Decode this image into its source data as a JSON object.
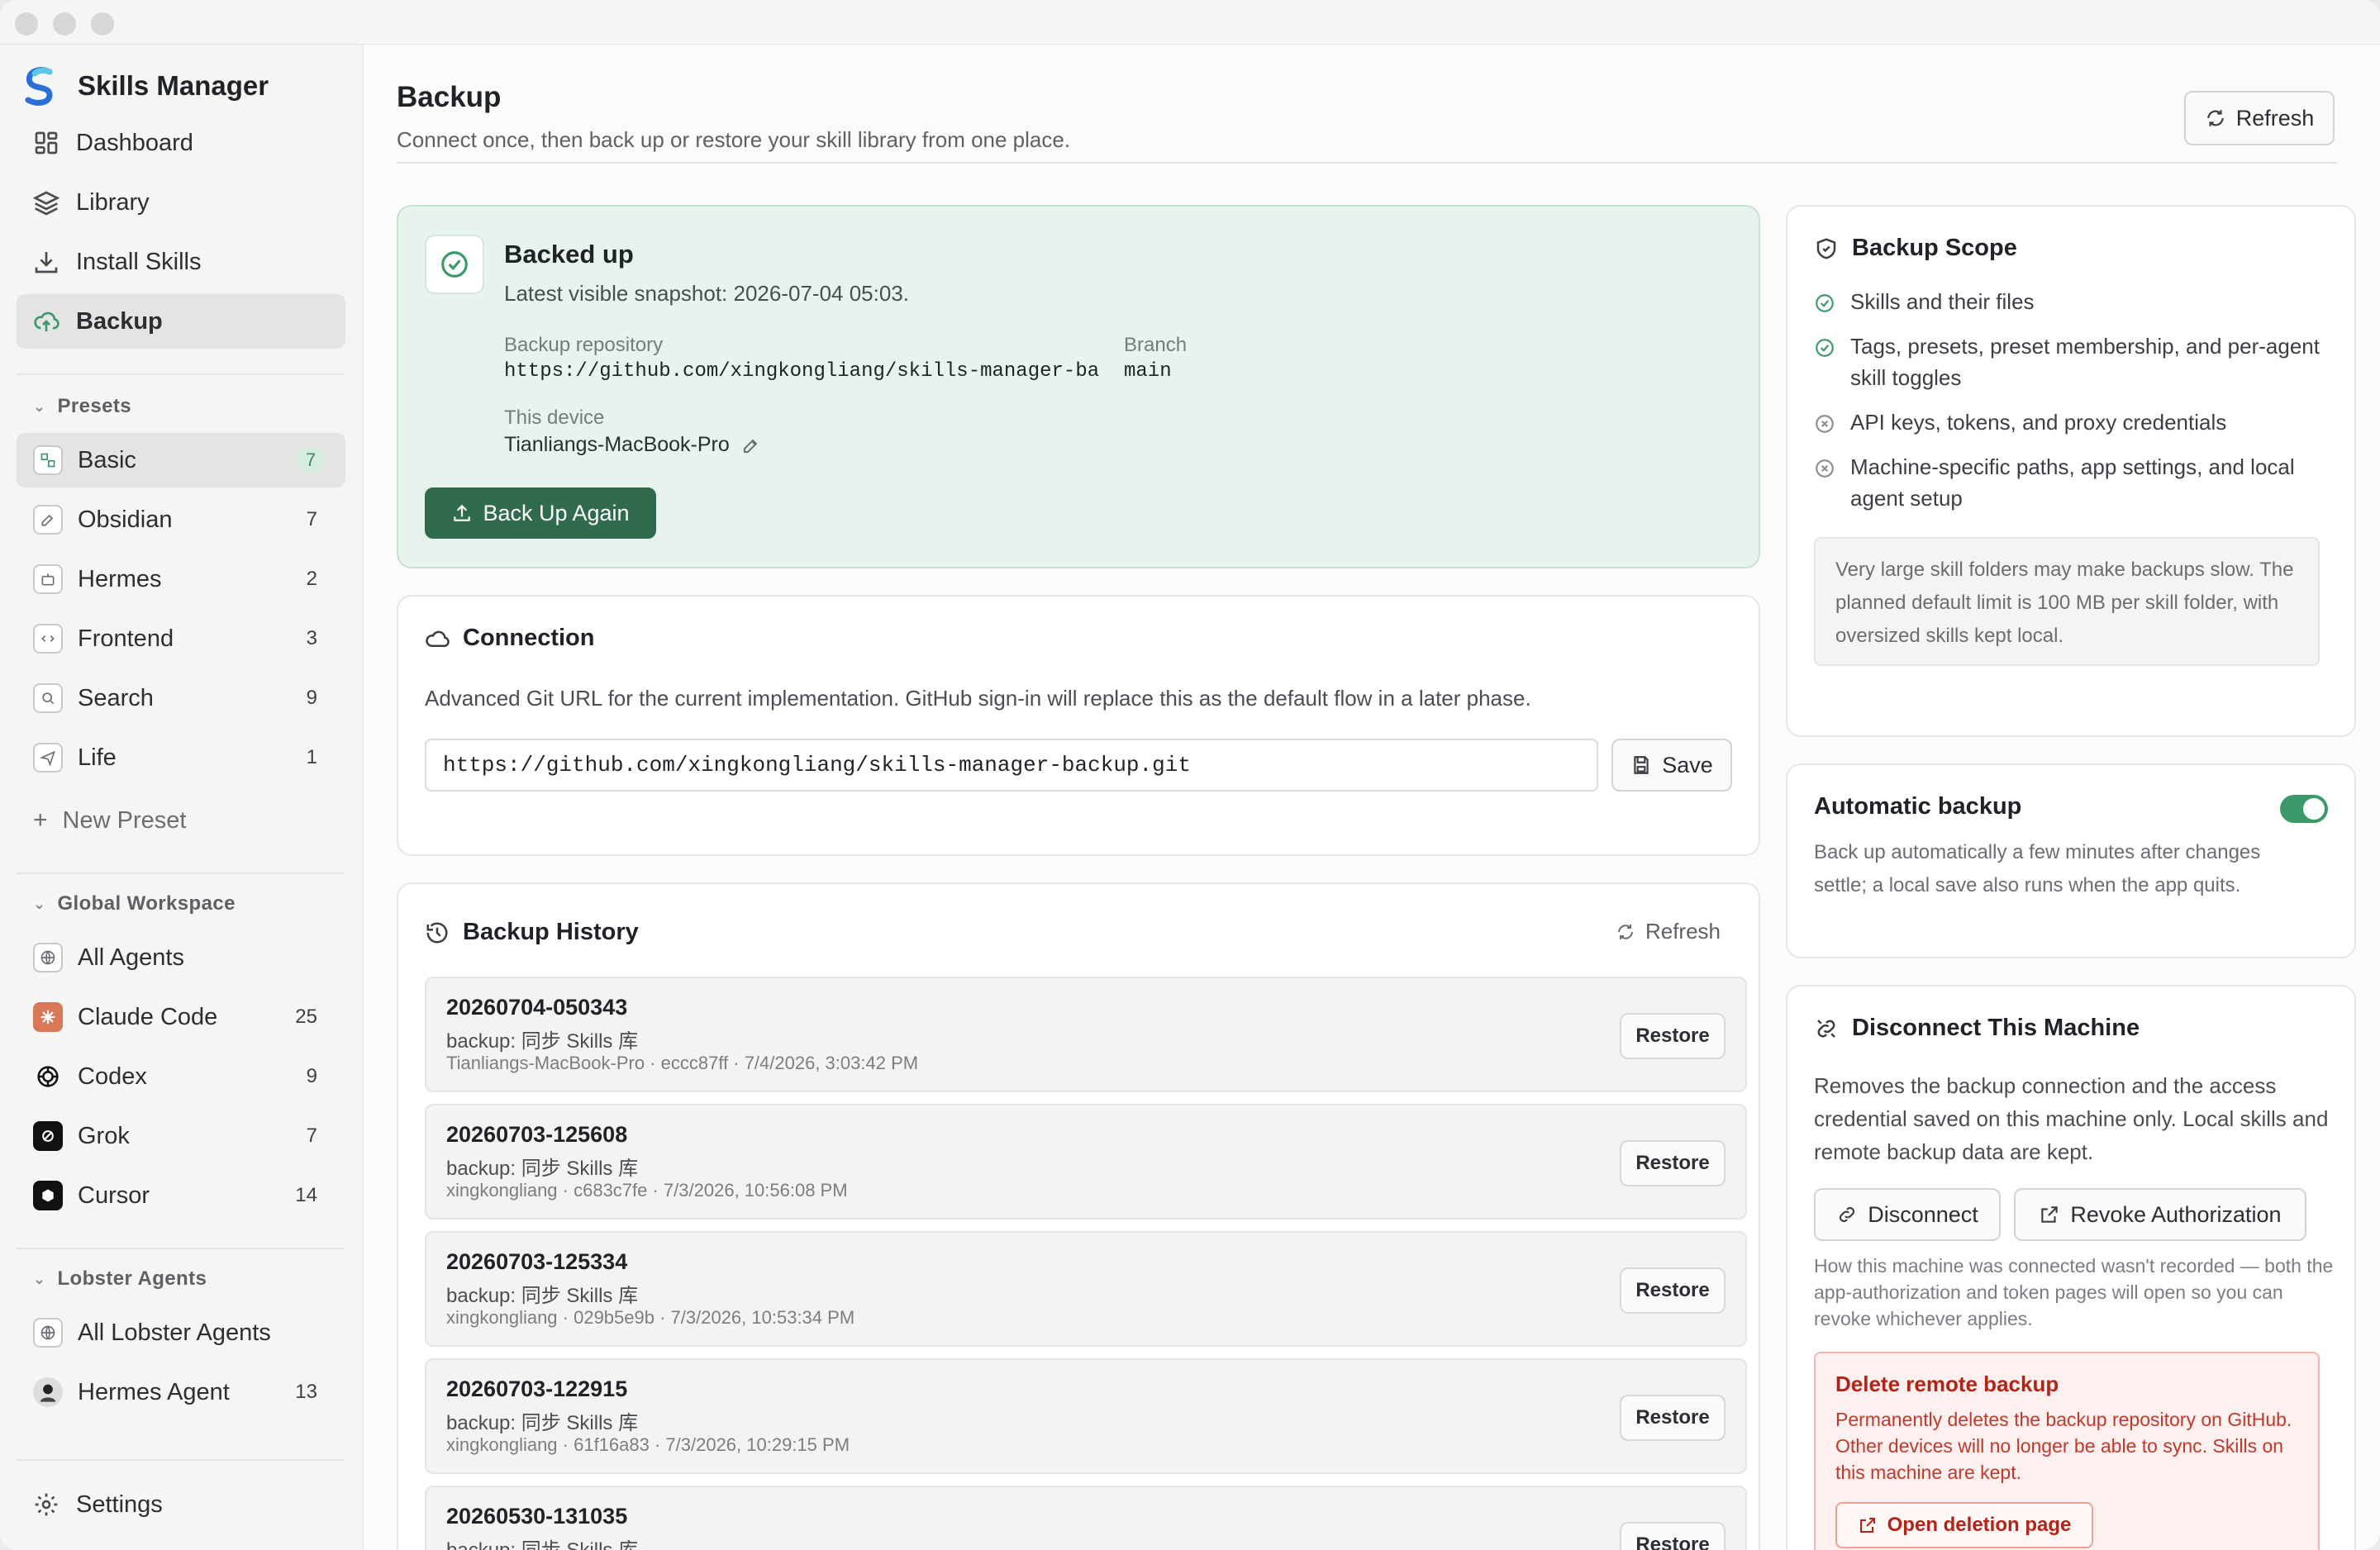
{
  "app": {
    "title": "Skills Manager"
  },
  "sidebar": {
    "nav": [
      {
        "label": "Dashboard",
        "icon": "dashboard-icon"
      },
      {
        "label": "Library",
        "icon": "layers-icon"
      },
      {
        "label": "Install Skills",
        "icon": "download-icon"
      },
      {
        "label": "Backup",
        "icon": "cloud-upload-icon"
      }
    ],
    "presets_header": "Presets",
    "presets": [
      {
        "label": "Basic",
        "count": "7"
      },
      {
        "label": "Obsidian",
        "count": "7"
      },
      {
        "label": "Hermes",
        "count": "2"
      },
      {
        "label": "Frontend",
        "count": "3"
      },
      {
        "label": "Search",
        "count": "9"
      },
      {
        "label": "Life",
        "count": "1"
      }
    ],
    "new_preset": "New Preset",
    "global_header": "Global Workspace",
    "global": [
      {
        "label": "All Agents",
        "count": ""
      },
      {
        "label": "Claude Code",
        "count": "25"
      },
      {
        "label": "Codex",
        "count": "9"
      },
      {
        "label": "Grok",
        "count": "7"
      },
      {
        "label": "Cursor",
        "count": "14"
      }
    ],
    "lobster_header": "Lobster Agents",
    "lobster": [
      {
        "label": "All Lobster Agents",
        "count": ""
      },
      {
        "label": "Hermes Agent",
        "count": "13"
      }
    ],
    "settings": "Settings"
  },
  "page": {
    "title": "Backup",
    "subtitle": "Connect once, then back up or restore your skill library from one place.",
    "refresh": "Refresh"
  },
  "status": {
    "title": "Backed up",
    "snapshot": "Latest visible snapshot: 2026-07-04 05:03.",
    "repo_label": "Backup repository",
    "repo_value": "https://github.com/xingkongliang/skills-manager-ba…",
    "branch_label": "Branch",
    "branch_value": "main",
    "device_label": "This device",
    "device_value": "Tianliangs-MacBook-Pro",
    "backup_btn": "Back Up Again"
  },
  "connection": {
    "title": "Connection",
    "desc": "Advanced Git URL for the current implementation. GitHub sign-in will replace this as the default flow in a later phase.",
    "url": "https://github.com/xingkongliang/skills-manager-backup.git",
    "save": "Save"
  },
  "history": {
    "title": "Backup History",
    "refresh": "Refresh",
    "restore": "Restore",
    "items": [
      {
        "id": "20260704-050343",
        "msg": "backup: 同步 Skills 库",
        "meta": "Tianliangs-MacBook-Pro · eccc87ff · 7/4/2026, 3:03:42 PM"
      },
      {
        "id": "20260703-125608",
        "msg": "backup: 同步 Skills 库",
        "meta": "xingkongliang · c683c7fe · 7/3/2026, 10:56:08 PM"
      },
      {
        "id": "20260703-125334",
        "msg": "backup: 同步 Skills 库",
        "meta": "xingkongliang · 029b5e9b · 7/3/2026, 10:53:34 PM"
      },
      {
        "id": "20260703-122915",
        "msg": "backup: 同步 Skills 库",
        "meta": "xingkongliang · 61f16a83 · 7/3/2026, 10:29:15 PM"
      },
      {
        "id": "20260530-131035",
        "msg": "backup: 同步 Skills 库",
        "meta": ""
      }
    ]
  },
  "scope": {
    "title": "Backup Scope",
    "items": [
      {
        "text": "Skills and their files",
        "included": true
      },
      {
        "text": "Tags, presets, preset membership, and per-agent skill toggles",
        "included": true
      },
      {
        "text": "API keys, tokens, and proxy credentials",
        "included": false
      },
      {
        "text": "Machine-specific paths, app settings, and local agent setup",
        "included": false
      }
    ],
    "note": "Very large skill folders may make backups slow. The planned default limit is 100 MB per skill folder, with oversized skills kept local."
  },
  "auto": {
    "title": "Automatic backup",
    "desc": "Back up automatically a few minutes after changes settle; a local save also runs when the app quits.",
    "enabled": true
  },
  "disconnect": {
    "title": "Disconnect This Machine",
    "desc": "Removes the backup connection and the access credential saved on this machine only. Local skills and remote backup data are kept.",
    "disconnect_btn": "Disconnect",
    "revoke_btn": "Revoke Authorization",
    "note": "How this machine was connected wasn't recorded — both the app-authorization and token pages will open so you can revoke whichever applies.",
    "danger_title": "Delete remote backup",
    "danger_desc": "Permanently deletes the backup repository on GitHub. Other devices will no longer be able to sync. Skills on this machine are kept.",
    "danger_btn": "Open deletion page"
  },
  "colors": {
    "accent": "#2f6b4c",
    "success": "#3c9a6a",
    "danger": "#b42318",
    "danger_bg": "#fdf0ef"
  }
}
